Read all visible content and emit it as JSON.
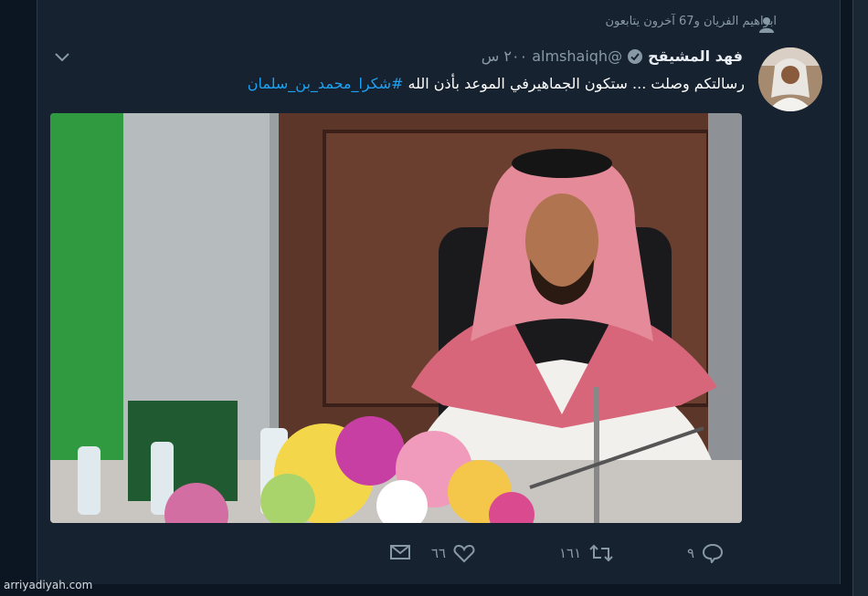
{
  "context": {
    "text": "ابراهيم الفريان و67 آخرون يتابعون"
  },
  "tweet": {
    "name": "فهد المشيقح",
    "handle": "@almshaiqh",
    "time": "٢٠٠ س",
    "text": "رسالتكم وصلت ... ستكون الجماهيرفي الموعد بأذن الله",
    "hashtag": "#شكرا_محمد_بن_سلمان"
  },
  "actions": {
    "replies": "٩",
    "retweets": "١٦١",
    "likes": "٦٦"
  },
  "colors": {
    "background": "#16222f",
    "accent": "#1da1f2",
    "verified": "#8899a6"
  },
  "icons": [
    "person-icon",
    "verified-badge-icon",
    "chevron-down-icon",
    "reply-icon",
    "retweet-icon",
    "like-icon",
    "message-icon"
  ],
  "footer": {
    "credit": "arriyadiyah.com"
  }
}
